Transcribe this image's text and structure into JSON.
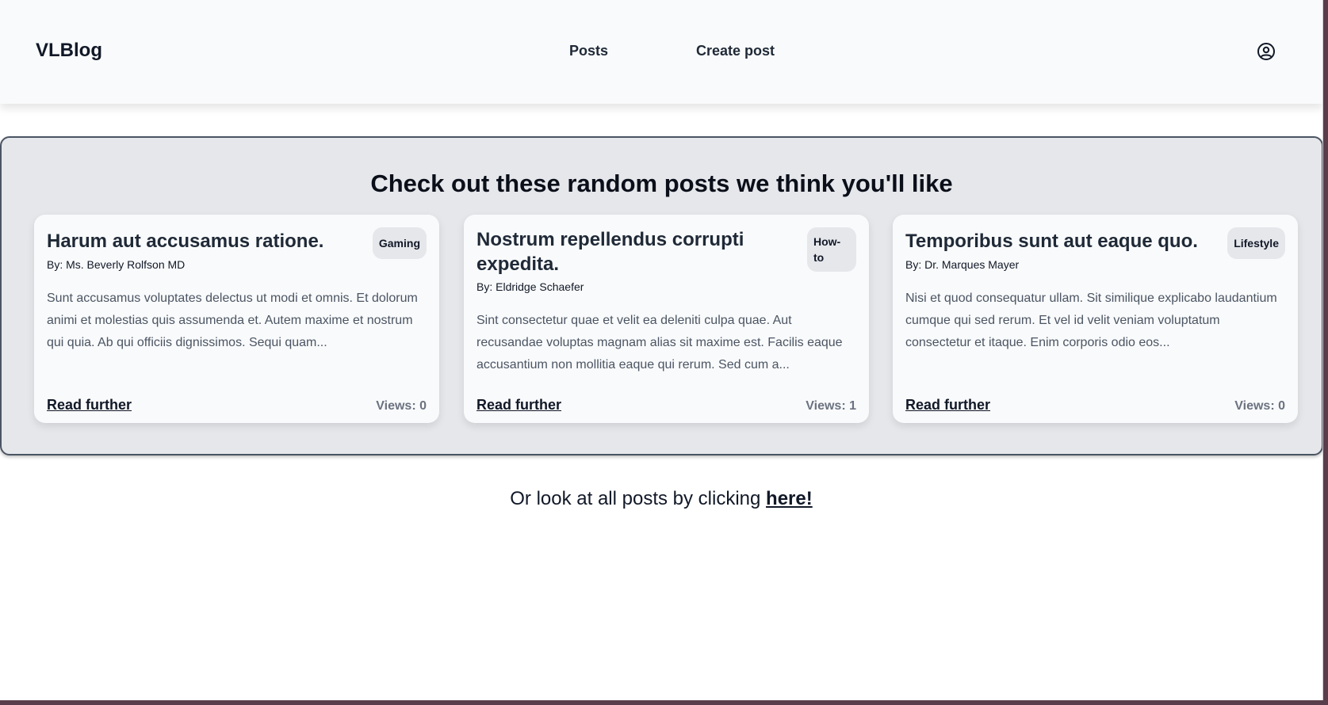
{
  "header": {
    "brand": "VLBlog",
    "nav": [
      {
        "label": "Posts"
      },
      {
        "label": "Create post"
      }
    ],
    "profile_icon": "user-circle-icon"
  },
  "featured": {
    "title": "Check out these random posts we think you'll like",
    "cards": [
      {
        "title": "Harum aut accusamus ratione.",
        "badge": "Gaming",
        "author": "By: Ms. Beverly Rolfson MD",
        "excerpt": "Sunt accusamus voluptates delectus ut modi et omnis. Et dolorum animi et molestias quis assumenda et. Autem maxime et nostrum qui quia. Ab qui officiis dignissimos. Sequi quam...",
        "read_label": "Read further",
        "views": "Views: 0"
      },
      {
        "title": "Nostrum repellendus corrupti expedita.",
        "badge": "How-to",
        "author": "By: Eldridge Schaefer",
        "excerpt": "Sint consectetur quae et velit ea deleniti culpa quae. Aut recusandae voluptas magnam alias sit maxime est. Facilis eaque accusantium non mollitia eaque qui rerum. Sed cum a...",
        "read_label": "Read further",
        "views": "Views: 1"
      },
      {
        "title": "Temporibus sunt aut eaque quo.",
        "badge": "Lifestyle",
        "author": "By: Dr. Marques Mayer",
        "excerpt": "Nisi et quod consequatur ullam. Sit similique explicabo laudantium cumque qui sed rerum. Et vel id velit veniam voluptatum consectetur et itaque. Enim corporis odio eos...",
        "read_label": "Read further",
        "views": "Views: 0"
      }
    ]
  },
  "footer": {
    "text": "Or look at all posts by clicking ",
    "link": "here!"
  }
}
